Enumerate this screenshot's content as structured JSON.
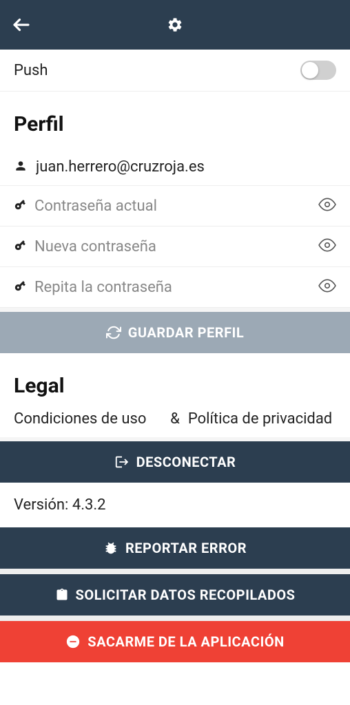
{
  "push": {
    "label": "Push",
    "enabled": false
  },
  "profile": {
    "title": "Perfil",
    "email": "juan.herrero@cruzroja.es",
    "currentPassword": {
      "placeholder": "Contraseña actual",
      "value": ""
    },
    "newPassword": {
      "placeholder": "Nueva contraseña",
      "value": ""
    },
    "repeatPassword": {
      "placeholder": "Repita la contraseña",
      "value": ""
    },
    "saveButton": "GUARDAR PERFIL"
  },
  "legal": {
    "title": "Legal",
    "terms": "Condiciones de uso",
    "amp": "&",
    "privacy": "Política de privacidad"
  },
  "buttons": {
    "logout": "DESCONECTAR",
    "report": "REPORTAR ERROR",
    "requestData": "SOLICITAR DATOS RECOPILADOS",
    "removeMe": "SACARME DE LA APLICACIÓN"
  },
  "versionLabel": "Versión: 4.3.2",
  "colors": {
    "dark": "#2c3e50",
    "red": "#ef4135",
    "gray": "#9ca9b5"
  }
}
